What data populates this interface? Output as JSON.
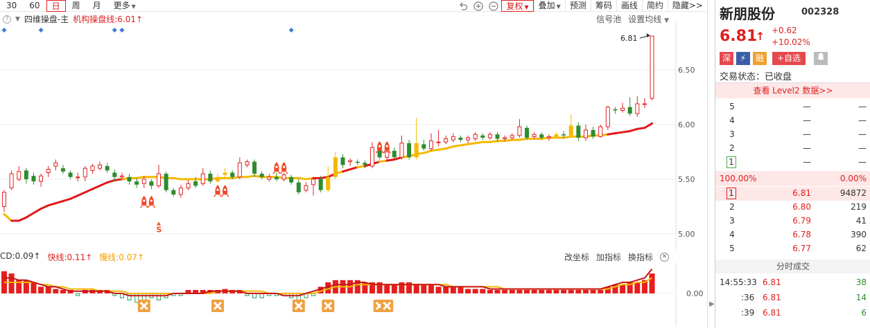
{
  "toolbar": {
    "periods": [
      "30",
      "60",
      "日",
      "周",
      "月",
      "更多"
    ],
    "active_period": "日",
    "buttons": [
      "复权",
      "叠加",
      "预测",
      "筹码",
      "画线",
      "简约",
      "隐藏>>"
    ]
  },
  "chart_header": {
    "indicator_name": "四维操盘-主",
    "line_label": "机构操盘线:6.01↑",
    "right_links": [
      "信号池",
      "设置均线"
    ]
  },
  "price_axis": {
    "ticks": [
      "6.50",
      "6.00",
      "5.50",
      "5.00"
    ],
    "last_price_label": "6.81"
  },
  "sub_header": {
    "labels": [
      {
        "text": "CD:0.09↑",
        "color": "#333333"
      },
      {
        "text": "快线:0.11↑",
        "color": "#e02020"
      },
      {
        "text": "慢线:0.07↑",
        "color": "#f0a000"
      }
    ],
    "right_links": [
      "改坐标",
      "加指标",
      "换指标"
    ],
    "axis_tick": "0.00"
  },
  "chart_data": {
    "type": "candlestick",
    "ylim": [
      4.86,
      6.95
    ],
    "candles": [
      [
        5.25,
        5.38,
        5.4,
        5.2
      ],
      [
        5.42,
        5.55,
        5.58,
        5.4
      ],
      [
        5.5,
        5.57,
        5.62,
        5.48
      ],
      [
        5.58,
        5.5,
        5.6,
        5.46
      ],
      [
        5.53,
        5.48,
        5.56,
        5.45
      ],
      [
        5.48,
        5.53,
        5.55,
        5.43
      ],
      [
        5.56,
        5.59,
        5.62,
        5.52
      ],
      [
        5.62,
        5.65,
        5.68,
        5.58
      ],
      [
        5.6,
        5.57,
        5.63,
        5.55
      ],
      [
        5.56,
        5.52,
        5.58,
        5.5
      ],
      [
        5.52,
        5.52,
        5.56,
        5.48
      ],
      [
        5.52,
        5.6,
        5.62,
        5.48
      ],
      [
        5.58,
        5.62,
        5.64,
        5.55
      ],
      [
        5.6,
        5.63,
        5.66,
        5.58
      ],
      [
        5.62,
        5.58,
        5.65,
        5.56
      ],
      [
        5.56,
        5.52,
        5.59,
        5.48
      ],
      [
        5.52,
        5.53,
        5.56,
        5.49
      ],
      [
        5.52,
        5.48,
        5.55,
        5.45
      ],
      [
        5.48,
        5.45,
        5.51,
        5.42
      ],
      [
        5.46,
        5.5,
        5.53,
        5.42
      ],
      [
        5.48,
        5.44,
        5.5,
        5.41
      ],
      [
        5.44,
        5.55,
        5.63,
        5.42
      ],
      [
        5.55,
        5.4,
        5.57,
        5.38
      ],
      [
        5.4,
        5.36,
        5.42,
        5.34
      ],
      [
        5.36,
        5.42,
        5.45,
        5.33
      ],
      [
        5.42,
        5.46,
        5.49,
        5.4
      ],
      [
        5.48,
        5.44,
        5.52,
        5.42
      ],
      [
        5.46,
        5.55,
        5.6,
        5.44
      ],
      [
        5.55,
        5.48,
        5.58,
        5.46
      ],
      [
        5.48,
        5.52,
        5.55,
        5.47
      ],
      [
        5.54,
        5.56,
        5.6,
        5.52
      ],
      [
        5.56,
        5.52,
        5.58,
        5.5
      ],
      [
        5.52,
        5.65,
        5.7,
        5.5
      ],
      [
        5.63,
        5.66,
        5.68,
        5.61
      ],
      [
        5.66,
        5.55,
        5.68,
        5.52
      ],
      [
        5.55,
        5.52,
        5.57,
        5.5
      ],
      [
        5.5,
        5.52,
        5.55,
        5.48
      ],
      [
        5.52,
        5.5,
        5.56,
        5.48
      ],
      [
        5.5,
        5.54,
        5.56,
        5.48
      ],
      [
        5.52,
        5.47,
        5.54,
        5.45
      ],
      [
        5.47,
        5.38,
        5.5,
        5.36
      ],
      [
        5.4,
        5.44,
        5.47,
        5.38
      ],
      [
        5.45,
        5.5,
        5.52,
        5.35
      ],
      [
        5.5,
        5.4,
        5.53,
        5.38
      ],
      [
        5.4,
        5.52,
        5.62,
        5.38
      ],
      [
        5.52,
        5.7,
        5.75,
        5.5
      ],
      [
        5.7,
        5.63,
        5.73,
        5.6
      ],
      [
        5.66,
        5.67,
        5.69,
        5.62
      ],
      [
        5.66,
        5.65,
        5.68,
        5.63
      ],
      [
        5.65,
        5.63,
        5.67,
        5.6
      ],
      [
        5.62,
        5.79,
        5.84,
        5.6
      ],
      [
        5.79,
        5.7,
        5.82,
        5.68
      ],
      [
        5.7,
        5.75,
        5.77,
        5.68
      ],
      [
        5.76,
        5.7,
        5.79,
        5.69
      ],
      [
        5.7,
        5.83,
        5.9,
        5.68
      ],
      [
        5.83,
        5.7,
        5.86,
        5.68
      ],
      [
        5.7,
        5.83,
        6.06,
        5.68
      ],
      [
        5.82,
        5.78,
        5.86,
        5.76
      ],
      [
        5.78,
        5.85,
        5.92,
        5.76
      ],
      [
        5.84,
        5.84,
        5.95,
        5.8
      ],
      [
        5.84,
        5.87,
        5.9,
        5.82
      ],
      [
        5.86,
        5.89,
        5.92,
        5.84
      ],
      [
        5.88,
        5.86,
        5.9,
        5.84
      ],
      [
        5.86,
        5.88,
        5.9,
        5.83
      ],
      [
        5.87,
        5.91,
        5.93,
        5.85
      ],
      [
        5.9,
        5.88,
        5.92,
        5.86
      ],
      [
        5.88,
        5.91,
        5.93,
        5.86
      ],
      [
        5.91,
        5.87,
        5.93,
        5.84
      ],
      [
        5.87,
        5.88,
        5.9,
        5.85
      ],
      [
        5.88,
        5.9,
        5.92,
        5.86
      ],
      [
        5.9,
        5.98,
        6.05,
        5.88
      ],
      [
        5.97,
        5.88,
        5.99,
        5.86
      ],
      [
        5.89,
        5.91,
        5.93,
        5.87
      ],
      [
        5.91,
        5.88,
        5.93,
        5.86
      ],
      [
        5.88,
        5.89,
        5.91,
        5.85
      ],
      [
        5.89,
        5.91,
        5.93,
        5.87
      ],
      [
        5.91,
        5.9,
        5.94,
        5.87
      ],
      [
        5.9,
        5.99,
        6.09,
        5.88
      ],
      [
        5.99,
        5.88,
        6.02,
        5.85
      ],
      [
        5.88,
        5.95,
        6.0,
        5.85
      ],
      [
        5.95,
        5.89,
        5.98,
        5.87
      ],
      [
        5.89,
        5.98,
        6.0,
        5.88
      ],
      [
        5.98,
        6.16,
        6.17,
        5.95
      ],
      [
        6.14,
        6.13,
        6.16,
        6.1
      ],
      [
        6.13,
        6.15,
        6.2,
        6.11
      ],
      [
        6.16,
        6.1,
        6.25,
        6.08
      ],
      [
        6.1,
        6.19,
        6.26,
        6.07
      ],
      [
        6.19,
        6.19,
        6.24,
        6.15
      ],
      [
        6.24,
        6.81,
        6.81,
        6.22
      ]
    ],
    "ma": [
      5.18,
      5.12,
      5.12,
      5.15,
      5.19,
      5.23,
      5.26,
      5.28,
      5.3,
      5.32,
      5.35,
      5.38,
      5.41,
      5.44,
      5.47,
      5.49,
      5.5,
      5.51,
      5.51,
      5.52,
      5.52,
      5.52,
      5.51,
      5.51,
      5.5,
      5.5,
      5.5,
      5.5,
      5.5,
      5.51,
      5.51,
      5.51,
      5.52,
      5.52,
      5.53,
      5.52,
      5.52,
      5.52,
      5.51,
      5.51,
      5.51,
      5.5,
      5.51,
      5.51,
      5.52,
      5.55,
      5.57,
      5.59,
      5.61,
      5.62,
      5.64,
      5.66,
      5.67,
      5.68,
      5.7,
      5.71,
      5.73,
      5.74,
      5.76,
      5.77,
      5.78,
      5.8,
      5.81,
      5.82,
      5.83,
      5.84,
      5.84,
      5.85,
      5.85,
      5.86,
      5.86,
      5.87,
      5.87,
      5.87,
      5.88,
      5.88,
      5.88,
      5.89,
      5.89,
      5.89,
      5.9,
      5.9,
      5.91,
      5.92,
      5.93,
      5.94,
      5.96,
      5.97,
      6.01
    ],
    "rockets": [
      19,
      20,
      29,
      30,
      37,
      38,
      51,
      52
    ],
    "s_signal": 21,
    "top_diamonds": [
      0,
      5,
      15,
      16,
      39
    ],
    "macd": [
      0.1,
      0.09,
      0.06,
      0.06,
      0.05,
      0.03,
      0.03,
      0.02,
      0.01,
      0.0,
      -0.01,
      0.0,
      0.01,
      0.01,
      0.0,
      -0.01,
      -0.02,
      -0.03,
      -0.04,
      -0.03,
      -0.02,
      -0.03,
      -0.02,
      -0.01,
      -0.01,
      0.0,
      0.0,
      0.0,
      0.01,
      0.01,
      0.02,
      0.01,
      0.0,
      -0.01,
      -0.02,
      -0.02,
      -0.01,
      -0.01,
      -0.01,
      -0.02,
      -0.04,
      -0.02,
      -0.01,
      0.03,
      0.05,
      0.06,
      0.06,
      0.06,
      0.06,
      0.05,
      0.05,
      0.05,
      0.04,
      0.04,
      0.05,
      0.05,
      0.04,
      0.04,
      0.04,
      0.03,
      0.03,
      0.03,
      0.03,
      0.02,
      0.02,
      0.02,
      0.01,
      0.01,
      0.01,
      0.01,
      0.0,
      0.0,
      0.01,
      0.01,
      0.01,
      0.01,
      0.0,
      0.01,
      0.01,
      0.01,
      0.01,
      0.01,
      0.03,
      0.04,
      0.04,
      0.05,
      0.05,
      0.06,
      0.09
    ],
    "fast": [
      0.07,
      0.07,
      0.06,
      0.06,
      0.05,
      0.04,
      0.03,
      0.03,
      0.02,
      0.01,
      0.01,
      0.01,
      0.01,
      0.01,
      0.01,
      0.0,
      0.0,
      -0.01,
      -0.01,
      -0.01,
      -0.01,
      -0.01,
      -0.01,
      0.0,
      0.0,
      0.0,
      0.0,
      0.0,
      0.01,
      0.01,
      0.01,
      0.01,
      0.01,
      0.0,
      0.0,
      0.0,
      0.0,
      0.0,
      -0.01,
      -0.01,
      -0.01,
      0.0,
      0.01,
      0.02,
      0.03,
      0.04,
      0.04,
      0.04,
      0.05,
      0.05,
      0.04,
      0.04,
      0.04,
      0.04,
      0.04,
      0.04,
      0.04,
      0.04,
      0.04,
      0.04,
      0.03,
      0.03,
      0.03,
      0.03,
      0.03,
      0.03,
      0.02,
      0.02,
      0.02,
      0.02,
      0.02,
      0.02,
      0.02,
      0.02,
      0.02,
      0.02,
      0.02,
      0.02,
      0.02,
      0.02,
      0.02,
      0.02,
      0.03,
      0.04,
      0.05,
      0.05,
      0.06,
      0.07,
      0.11
    ],
    "slow": [
      0.05,
      0.05,
      0.05,
      0.05,
      0.05,
      0.04,
      0.04,
      0.03,
      0.03,
      0.02,
      0.02,
      0.02,
      0.02,
      0.01,
      0.01,
      0.01,
      0.01,
      0.0,
      0.0,
      0.0,
      0.0,
      0.0,
      0.0,
      0.0,
      0.0,
      0.0,
      0.0,
      0.0,
      0.0,
      0.01,
      0.01,
      0.01,
      0.01,
      0.01,
      0.01,
      0.01,
      0.0,
      0.0,
      0.0,
      0.0,
      0.0,
      0.0,
      0.0,
      0.01,
      0.02,
      0.03,
      0.03,
      0.03,
      0.04,
      0.04,
      0.04,
      0.04,
      0.04,
      0.04,
      0.04,
      0.04,
      0.04,
      0.04,
      0.04,
      0.04,
      0.04,
      0.03,
      0.03,
      0.03,
      0.03,
      0.03,
      0.03,
      0.03,
      0.02,
      0.02,
      0.02,
      0.02,
      0.02,
      0.02,
      0.02,
      0.02,
      0.02,
      0.02,
      0.02,
      0.02,
      0.02,
      0.02,
      0.02,
      0.03,
      0.04,
      0.04,
      0.05,
      0.05,
      0.07
    ],
    "cross_signals": [
      19,
      29,
      40,
      44,
      51,
      52
    ]
  },
  "side": {
    "name": "新朋股份",
    "code": "002328",
    "price": "6.81",
    "change": "+0.62",
    "change_pct": "+10.02%",
    "badges": [
      "深",
      "⚡",
      "融",
      "+自选"
    ],
    "status": "交易状态：已收盘",
    "level2": "查看 Level2 数据>>",
    "asks": [
      {
        "lvl": "5",
        "px": "—",
        "vol": "—"
      },
      {
        "lvl": "4",
        "px": "—",
        "vol": "—"
      },
      {
        "lvl": "3",
        "px": "—",
        "vol": "—"
      },
      {
        "lvl": "2",
        "px": "—",
        "vol": "—"
      },
      {
        "lvl": "1",
        "px": "—",
        "vol": "—"
      }
    ],
    "ratio_left": "100.00%",
    "ratio_right": "0.00%",
    "bids": [
      {
        "lvl": "1",
        "px": "6.81",
        "vol": "94872"
      },
      {
        "lvl": "2",
        "px": "6.80",
        "vol": "219"
      },
      {
        "lvl": "3",
        "px": "6.79",
        "vol": "41"
      },
      {
        "lvl": "4",
        "px": "6.78",
        "vol": "390"
      },
      {
        "lvl": "5",
        "px": "6.77",
        "vol": "62"
      }
    ],
    "ticks_title": "分时成交",
    "ticks": [
      {
        "time": "14:55:33",
        "px": "6.81",
        "vol": "38"
      },
      {
        "time": ":36",
        "px": "6.81",
        "vol": "14"
      },
      {
        "time": ":39",
        "px": "6.81",
        "vol": "6"
      }
    ]
  }
}
